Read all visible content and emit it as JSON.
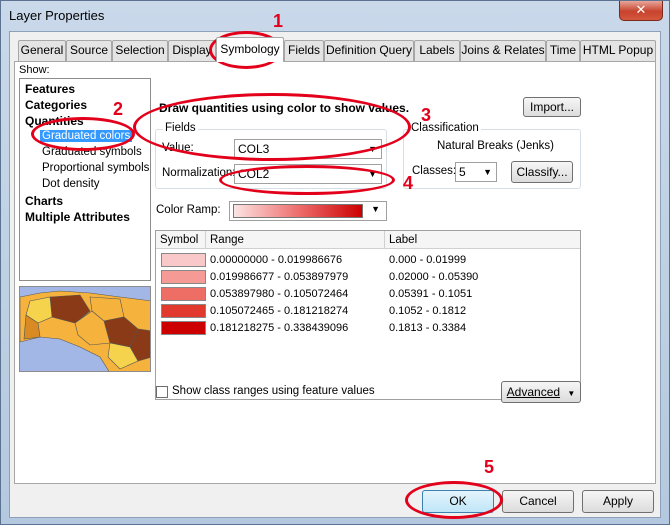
{
  "window": {
    "title": "Layer Properties",
    "close_glyph": "✕"
  },
  "tabs": [
    {
      "label": "General"
    },
    {
      "label": "Source"
    },
    {
      "label": "Selection"
    },
    {
      "label": "Display"
    },
    {
      "label": "Symbology"
    },
    {
      "label": "Fields"
    },
    {
      "label": "Definition Query"
    },
    {
      "label": "Labels"
    },
    {
      "label": "Joins & Relates"
    },
    {
      "label": "Time"
    },
    {
      "label": "HTML Popup"
    }
  ],
  "show": {
    "label": "Show:",
    "items": [
      {
        "label": "Features"
      },
      {
        "label": "Categories"
      },
      {
        "label": "Quantities"
      },
      {
        "label": "Graduated colors"
      },
      {
        "label": "Graduated symbols"
      },
      {
        "label": "Proportional symbols"
      },
      {
        "label": "Dot density"
      },
      {
        "label": "Charts"
      },
      {
        "label": "Multiple Attributes"
      }
    ]
  },
  "description": "Draw quantities using color to show values.",
  "import_label": "Import...",
  "fields": {
    "group_label": "Fields",
    "value_label": "Value:",
    "value": "COL3",
    "normalization_label": "Normalization:",
    "normalization": "COL2"
  },
  "classification": {
    "group_label": "Classification",
    "method": "Natural Breaks (Jenks)",
    "classes_label": "Classes:",
    "classes": "5",
    "classify_label": "Classify..."
  },
  "color_ramp_label": "Color Ramp:",
  "table": {
    "headers": {
      "symbol": "Symbol",
      "range": "Range",
      "label": "Label"
    },
    "rows": [
      {
        "color": "#f9c9c9",
        "range": "0.00000000 - 0.019986676",
        "label": "0.000 - 0.01999"
      },
      {
        "color": "#f59a95",
        "range": "0.019986677 - 0.053897979",
        "label": "0.02000 - 0.05390"
      },
      {
        "color": "#ee6e66",
        "range": "0.053897980 - 0.105072464",
        "label": "0.05391 - 0.1051"
      },
      {
        "color": "#e2392f",
        "range": "0.105072465 - 0.181218274",
        "label": "0.1052 - 0.1812"
      },
      {
        "color": "#cc0000",
        "range": "0.181218275 - 0.338439096",
        "label": "0.1813 - 0.3384"
      }
    ]
  },
  "show_class_ranges_label": "Show class ranges using feature values",
  "advanced_label": "Advanced",
  "footer": {
    "ok": "OK",
    "cancel": "Cancel",
    "apply": "Apply"
  },
  "annotations": [
    "1",
    "2",
    "3",
    "4",
    "5"
  ],
  "colors": {
    "annotation": "#e3001b",
    "ok_highlight": "#bfe6f8",
    "selection": "#3399ff"
  }
}
